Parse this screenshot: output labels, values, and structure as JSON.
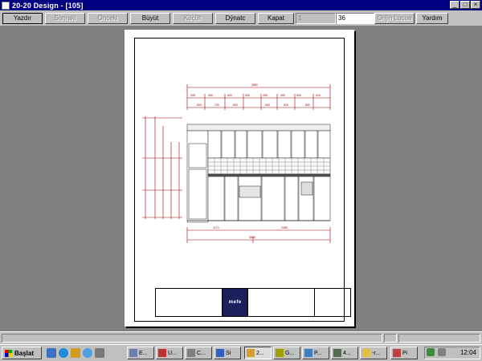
{
  "window": {
    "title": "20-20 Design - [105]"
  },
  "toolbar": {
    "print": "Yazdır",
    "next": "Sonraki",
    "prev": "Önceki",
    "zoom_in": "Büyüt",
    "zoom_out": "Küçült",
    "settings": "Dýnatc",
    "close": "Kapat",
    "page_field": "1",
    "zoom_field": "36",
    "origin": "Orijin Lucua",
    "help": "Yardım"
  },
  "drawing": {
    "logo_text": "mefe"
  },
  "taskbar": {
    "start": "Başlat",
    "tasks": [
      "E...",
      "U...",
      "C...",
      "Si",
      "2...",
      "G...",
      "P...",
      "4...",
      "-r...",
      "Pi"
    ],
    "clock": "12:04"
  },
  "colors": {
    "titlebar": "#000080",
    "chrome": "#c0c0c0",
    "background": "#808080",
    "dimension": "#a00000"
  }
}
